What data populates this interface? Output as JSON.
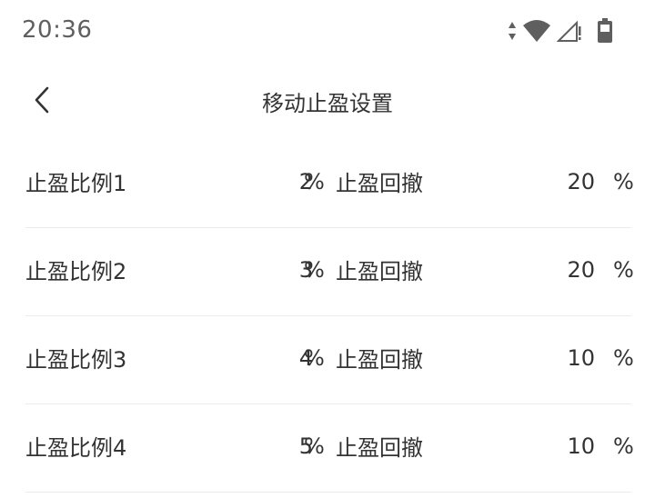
{
  "status_bar": {
    "time": "20:36",
    "icons": [
      "data-arrows-icon",
      "wifi-icon",
      "signal-icon",
      "battery-icon"
    ]
  },
  "nav": {
    "title": "移动止盈设置",
    "back_icon": "chevron-left-icon"
  },
  "rows": [
    {
      "label": "止盈比例1",
      "ratio": "2",
      "ratio_unit": "%",
      "pullback_label": "止盈回撤",
      "pullback": "20",
      "pullback_unit": "%"
    },
    {
      "label": "止盈比例2",
      "ratio": "3",
      "ratio_unit": "%",
      "pullback_label": "止盈回撤",
      "pullback": "20",
      "pullback_unit": "%"
    },
    {
      "label": "止盈比例3",
      "ratio": "4",
      "ratio_unit": "%",
      "pullback_label": "止盈回撤",
      "pullback": "10",
      "pullback_unit": "%"
    },
    {
      "label": "止盈比例4",
      "ratio": "5",
      "ratio_unit": "%",
      "pullback_label": "止盈回撤",
      "pullback": "10",
      "pullback_unit": "%"
    }
  ]
}
